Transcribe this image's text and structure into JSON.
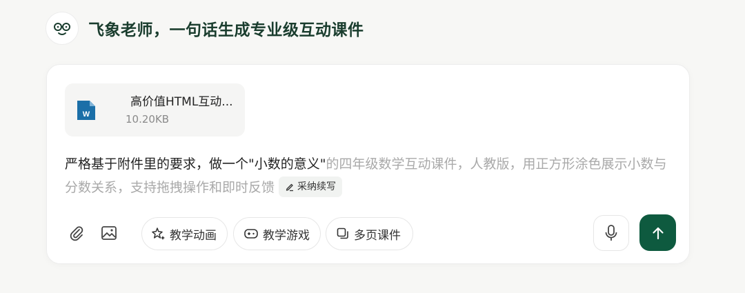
{
  "header": {
    "title": "飞象老师，一句话生成专业级互动课件",
    "avatar_icon": "glasses-face-icon"
  },
  "attachment": {
    "name": "高价值HTML互动...",
    "size": "10.20KB",
    "icon": "word-document-icon",
    "icon_color": "#1b6fa8"
  },
  "prompt": {
    "typed": "严格基于附件里的要求，做一个\"小数的意义\"",
    "suggestion": "的四年级数学互动课件，人教版，用正方形涂色展示小数与分数关系，支持拖拽操作和即时反馈",
    "adopt_label": "采纳续写"
  },
  "toolbar": {
    "attach_icon": "paperclip-icon",
    "image_icon": "image-icon",
    "chips": [
      {
        "label": "教学动画",
        "icon": "sparkle-icon"
      },
      {
        "label": "教学游戏",
        "icon": "gamepad-icon"
      },
      {
        "label": "多页课件",
        "icon": "pages-icon"
      }
    ],
    "mic_icon": "microphone-icon",
    "send_icon": "arrow-up-icon"
  },
  "colors": {
    "accent": "#0e5a3f",
    "title": "#1a3d2e",
    "muted_text": "#a9a9a9"
  }
}
